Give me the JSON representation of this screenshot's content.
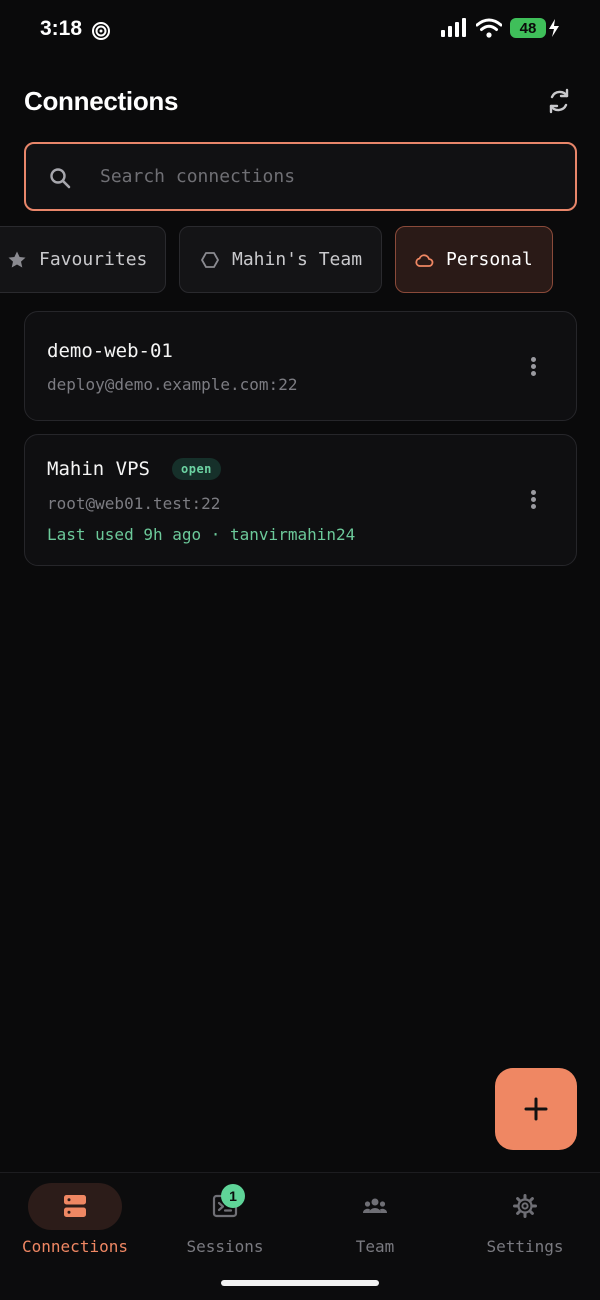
{
  "status_bar": {
    "time": "3:18",
    "battery": "48",
    "icons": [
      "focus-icon",
      "signal-icon",
      "wifi-icon",
      "battery-icon",
      "charging-icon"
    ]
  },
  "header": {
    "title": "Connections",
    "sync_icon": "sync-icon"
  },
  "search": {
    "placeholder": "Search connections",
    "value": ""
  },
  "filters": [
    {
      "label": "Favourites",
      "icon": "star-icon",
      "selected": false
    },
    {
      "label": "Mahin's Team",
      "icon": "hexagon-icon",
      "selected": false
    },
    {
      "label": "Personal",
      "icon": "cloud-icon",
      "selected": true
    }
  ],
  "connections": [
    {
      "name": "demo-web-01",
      "address": "deploy@demo.example.com:22"
    },
    {
      "name": "Mahin VPS",
      "badge": "open",
      "address": "root@web01.test:22",
      "meta": "Last used 9h ago · tanvirmahin24"
    }
  ],
  "fab": {
    "icon": "plus-icon"
  },
  "nav": [
    {
      "label": "Connections",
      "icon": "server-icon",
      "active": true
    },
    {
      "label": "Sessions",
      "icon": "terminal-icon",
      "badge": "1",
      "active": false
    },
    {
      "label": "Team",
      "icon": "people-icon",
      "active": false
    },
    {
      "label": "Settings",
      "icon": "gear-icon",
      "active": false
    }
  ],
  "colors": {
    "accent": "#ef8763",
    "background": "#0a0a0b",
    "success": "#6cc99a"
  }
}
